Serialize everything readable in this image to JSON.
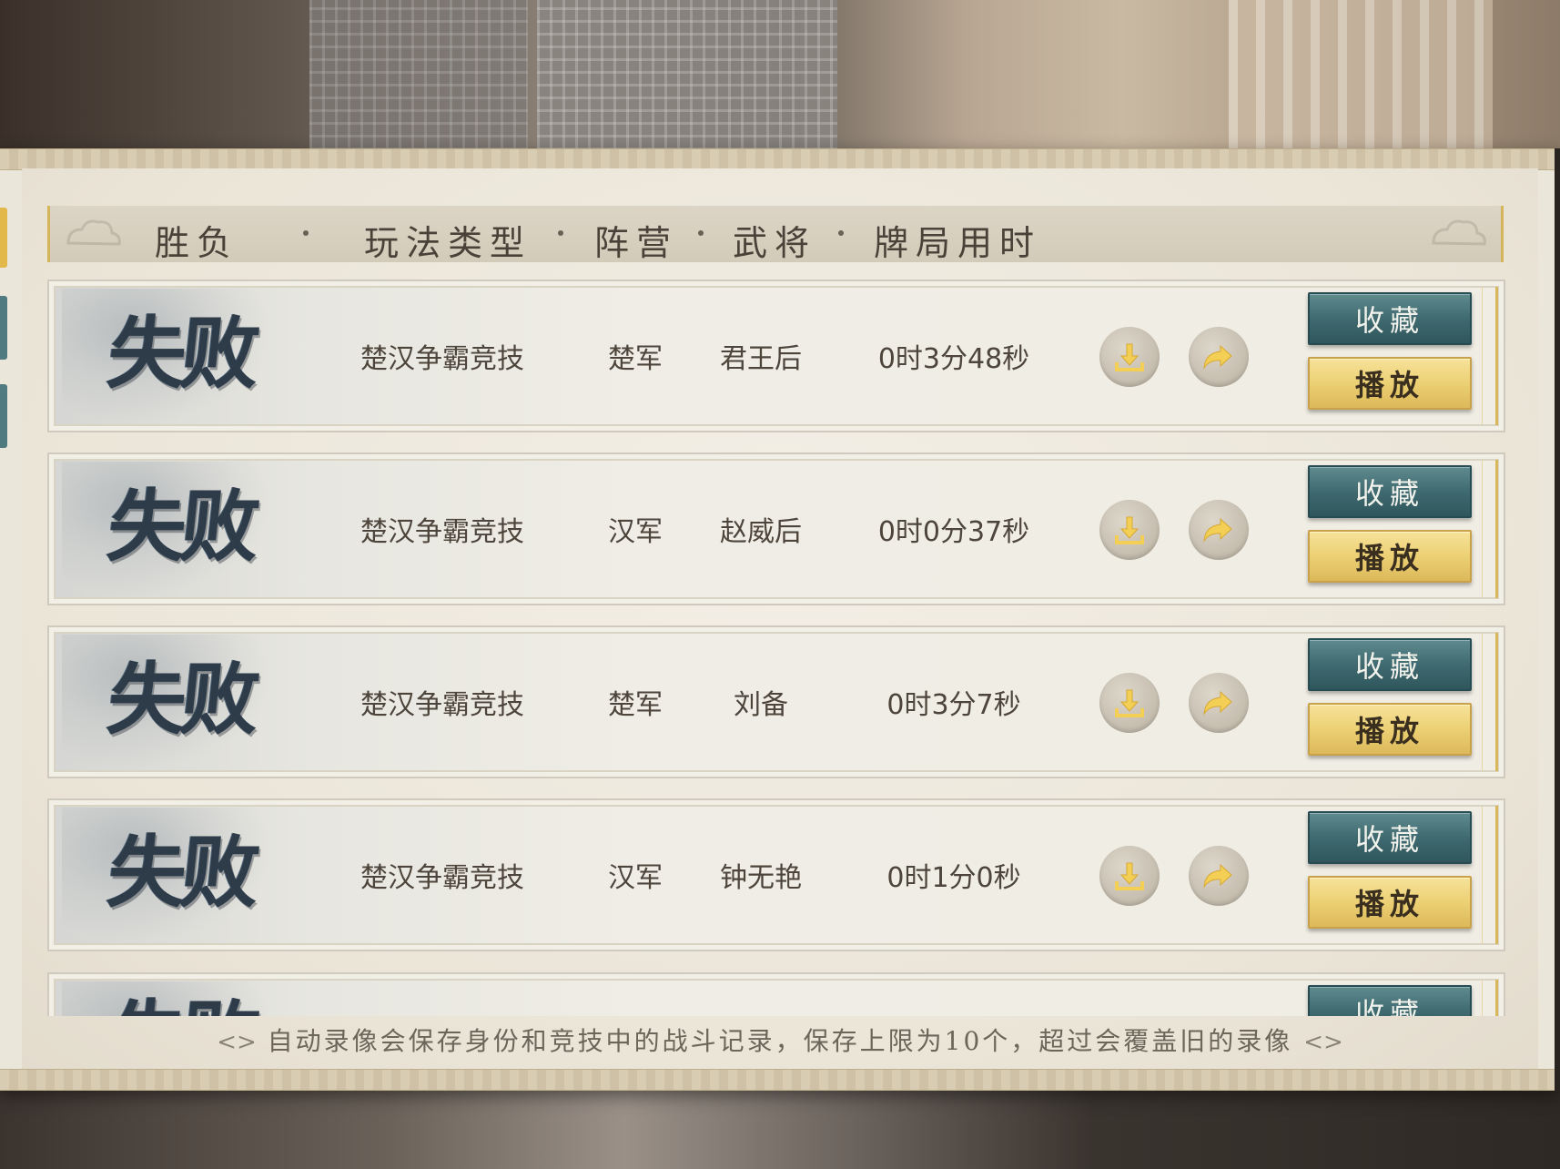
{
  "header": {
    "col_result": "胜负",
    "col_mode": "玩法类型",
    "col_camp": "阵营",
    "col_hero": "武将",
    "col_time": "牌局用时"
  },
  "records": [
    {
      "result": "失败",
      "mode": "楚汉争霸竞技",
      "camp": "楚军",
      "hero": "君王后",
      "time": "0时3分48秒",
      "fav_label": "收藏",
      "play_label": "播放"
    },
    {
      "result": "失败",
      "mode": "楚汉争霸竞技",
      "camp": "汉军",
      "hero": "赵威后",
      "time": "0时0分37秒",
      "fav_label": "收藏",
      "play_label": "播放"
    },
    {
      "result": "失败",
      "mode": "楚汉争霸竞技",
      "camp": "楚军",
      "hero": "刘备",
      "time": "0时3分7秒",
      "fav_label": "收藏",
      "play_label": "播放"
    },
    {
      "result": "失败",
      "mode": "楚汉争霸竞技",
      "camp": "汉军",
      "hero": "钟无艳",
      "time": "0时1分0秒",
      "fav_label": "收藏",
      "play_label": "播放"
    },
    {
      "result": "失败",
      "mode": "",
      "camp": "",
      "hero": "",
      "time": "",
      "fav_label": "收藏",
      "play_label": ""
    }
  ],
  "footer": {
    "note": "自动录像会保存身份和竞技中的战斗记录，保存上限为10个，超过会覆盖旧的录像"
  },
  "icons": {
    "download": "download-icon",
    "share": "share-icon"
  },
  "colors": {
    "fav_button": "#3f6a70",
    "play_button": "#ecd074",
    "result_ink": "#2e3c4a"
  }
}
